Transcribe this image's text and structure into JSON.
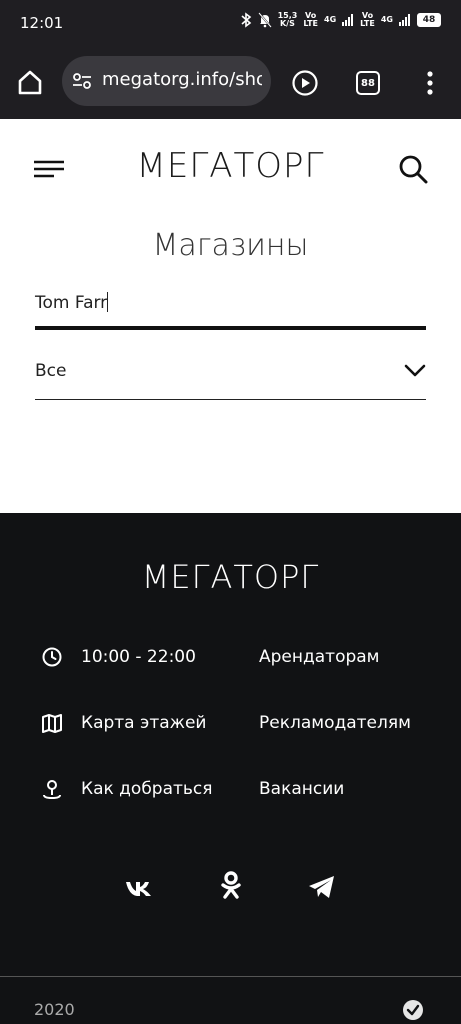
{
  "status_bar": {
    "time": "12:01",
    "net_speed": "15,3\nK/S",
    "volte1": "Vo\nLTE",
    "signal1": "4G",
    "volte2": "Vo\nLTE",
    "signal2": "4G",
    "battery": "48"
  },
  "browser": {
    "url": "megatorg.info/shops",
    "tab_count": "88"
  },
  "header": {
    "brand": "МЕГАТОРГ"
  },
  "main": {
    "title": "Магазины",
    "search_value": "Tom Farr",
    "category_value": "Все"
  },
  "footer": {
    "brand": "МЕГАТОРГ",
    "hours": "10:00 - 22:00",
    "map": "Карта этажей",
    "directions": "Как добраться",
    "links": [
      "Арендаторам",
      "Рекламодателям",
      "Вакансии"
    ],
    "copyright": "2020"
  },
  "colors": {
    "dark": "#1f1e22",
    "footer": "#111214",
    "pill": "#3a393e"
  }
}
